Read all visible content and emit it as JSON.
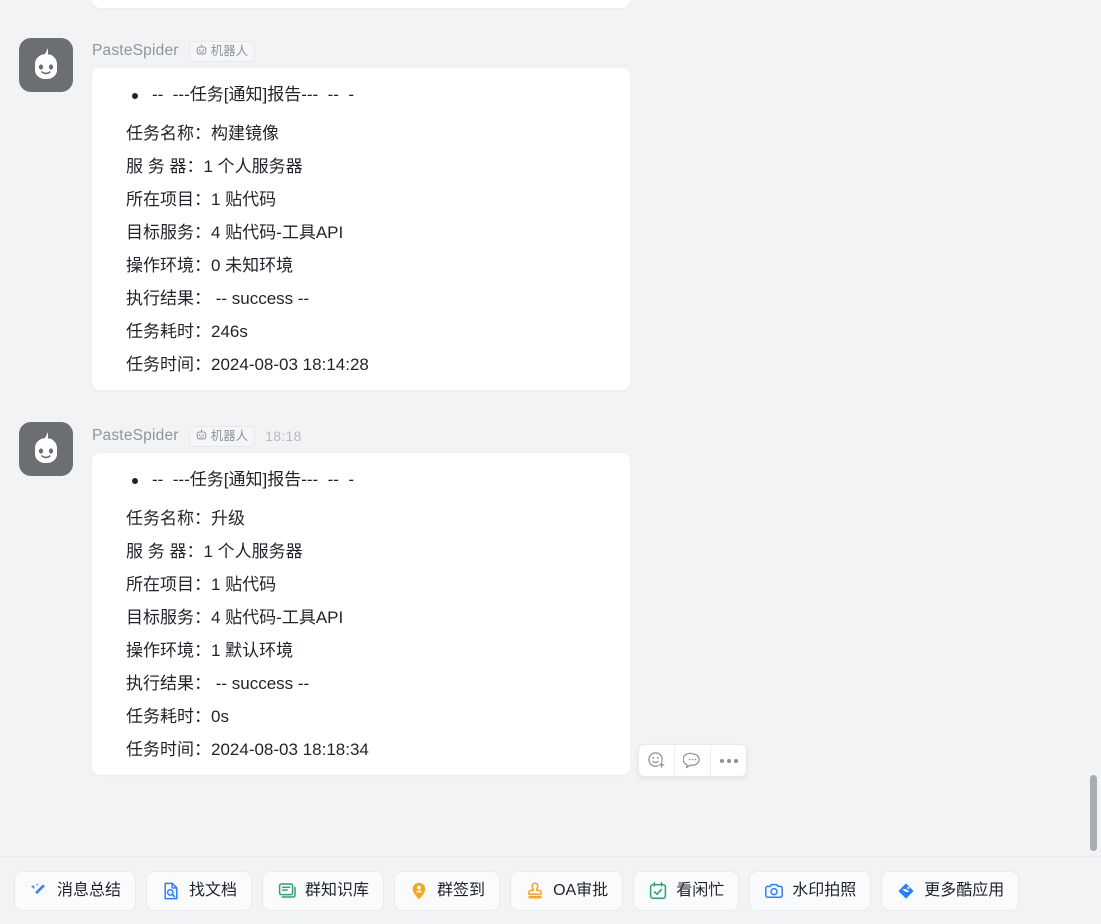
{
  "theme": {
    "background": "#f2f3f5",
    "bubble_bg": "#ffffff",
    "text": "#1f2329",
    "muted": "#8f959e"
  },
  "messages": [
    {
      "sender": "PasteSpider",
      "badge": "机器人",
      "time": "",
      "avatar_icon": "robot-avatar-icon",
      "title_line": "--  ---任务[通知]报告---  --  -",
      "rows": [
        "任务名称：构建镜像",
        "服 务 器：1 个人服务器",
        "所在项目：1 贴代码",
        "目标服务：4 贴代码-工具API",
        "操作环境：0 未知环境",
        "执行结果： -- success --",
        "任务耗时：246s",
        "任务时间：2024-08-03 18:14:28"
      ]
    },
    {
      "sender": "PasteSpider",
      "badge": "机器人",
      "time": "18:18",
      "avatar_icon": "robot-avatar-icon",
      "title_line": "--  ---任务[通知]报告---  --  -",
      "rows": [
        "任务名称：升级",
        "服 务 器：1 个人服务器",
        "所在项目：1 贴代码",
        "目标服务：4 贴代码-工具API",
        "操作环境：1 默认环境",
        "执行结果： -- success --",
        "任务耗时：0s",
        "任务时间：2024-08-03 18:18:34"
      ]
    }
  ],
  "hover_actions": [
    {
      "name": "add-reaction",
      "icon": "emoji-add-icon"
    },
    {
      "name": "reply",
      "icon": "speech-bubble-icon"
    },
    {
      "name": "more",
      "icon": "more-ellipsis-icon"
    }
  ],
  "bottom_bar": {
    "apps": [
      {
        "label": "消息总结",
        "icon": "sparkle-wand-icon",
        "color": "#2b7fff"
      },
      {
        "label": "找文档",
        "icon": "document-search-icon",
        "color": "#2b7fff"
      },
      {
        "label": "群知识库",
        "icon": "book-stack-icon",
        "color": "#2ba471"
      },
      {
        "label": "群签到",
        "icon": "location-pin-user-icon",
        "color": "#f5a623"
      },
      {
        "label": "OA审批",
        "icon": "stamp-icon",
        "color": "#f5a623"
      },
      {
        "label": "看闲忙",
        "icon": "calendar-check-icon",
        "color": "#2ba471"
      },
      {
        "label": "水印拍照",
        "icon": "camera-icon",
        "color": "#2b7fff"
      },
      {
        "label": "更多酷应用",
        "icon": "diamond-apps-icon",
        "color": "#2b7fff"
      }
    ]
  }
}
